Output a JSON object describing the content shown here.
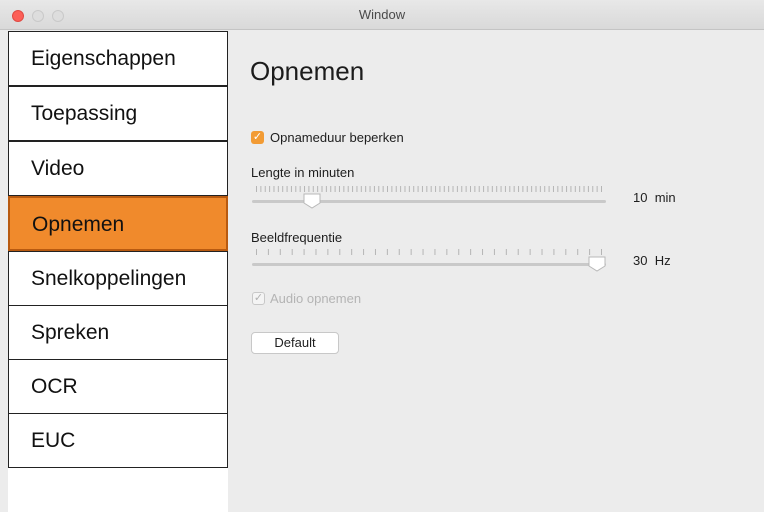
{
  "window": {
    "title": "Window"
  },
  "sidebar": {
    "items": [
      {
        "label": "Eigenschappen",
        "active": false
      },
      {
        "label": "Toepassing",
        "active": false
      },
      {
        "label": "Video",
        "active": false
      },
      {
        "label": "Opnemen",
        "active": true
      },
      {
        "label": "Snelkoppelingen",
        "active": false
      },
      {
        "label": "Spreken",
        "active": false
      },
      {
        "label": "OCR",
        "active": false
      },
      {
        "label": "EUC",
        "active": false
      }
    ]
  },
  "main": {
    "title": "Opnemen",
    "limit_duration": {
      "label": "Opnameduur beperken",
      "checked": true,
      "enabled": true
    },
    "length_slider": {
      "label": "Lengte in minuten",
      "value": "10",
      "unit": "min",
      "position_fraction": 0.17
    },
    "framerate_slider": {
      "label": "Beeldfrequentie",
      "value": "30",
      "unit": "Hz",
      "position_fraction": 1.0
    },
    "audio": {
      "label": "Audio opnemen",
      "checked": true,
      "enabled": false
    },
    "default_button": {
      "label": "Default"
    }
  },
  "colors": {
    "accent": "#f08a2c",
    "close_button": "#fc5f57"
  }
}
